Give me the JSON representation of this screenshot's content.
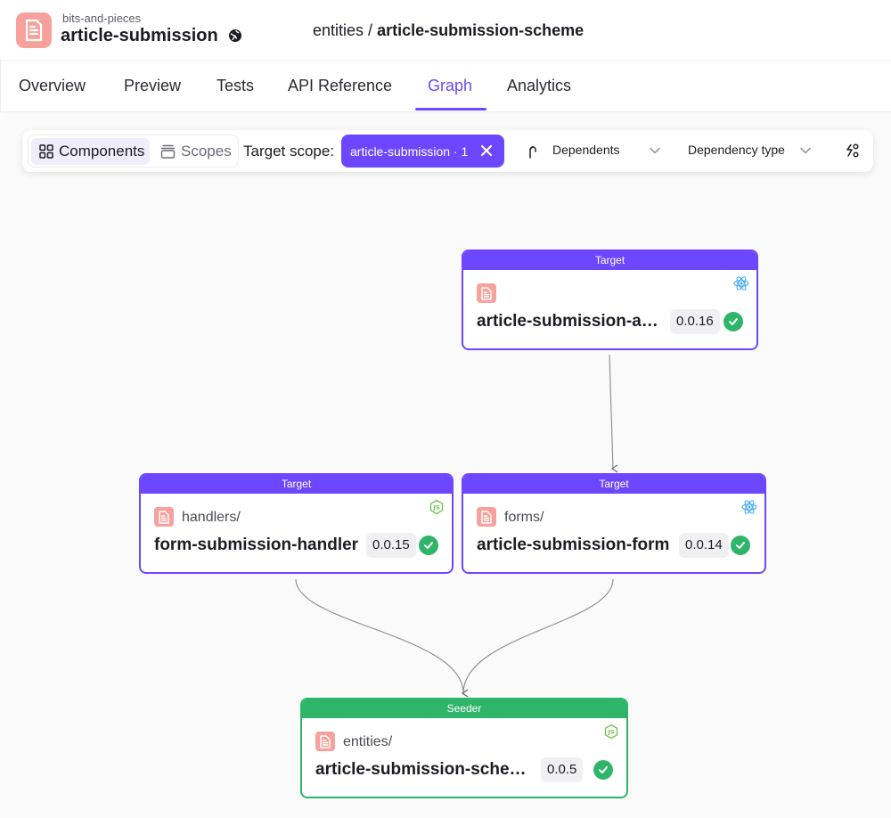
{
  "header": {
    "org": "bits-and-pieces",
    "scope": "article-submission",
    "breadcrumb_namespace": "entities",
    "breadcrumb_separator": " / ",
    "breadcrumb_component": "article-submission-scheme"
  },
  "tabs": [
    {
      "label": "Overview"
    },
    {
      "label": "Preview"
    },
    {
      "label": "Tests"
    },
    {
      "label": "API Reference"
    },
    {
      "label": "Graph",
      "active": true
    },
    {
      "label": "Analytics"
    }
  ],
  "toolbar": {
    "components_label": "Components",
    "scopes_label": "Scopes",
    "target_scope_label": "Target scope:",
    "target_scope_chip": "article-submission · 1",
    "dependents_label": "Dependents",
    "dependency_type_label": "Dependency type"
  },
  "nodes": [
    {
      "header": "Target",
      "namespace": "",
      "name": "article-submission-app",
      "version": "0.0.16",
      "env": "react-icon"
    },
    {
      "header": "Target",
      "namespace": "handlers/",
      "name": "form-submission-handler",
      "version": "0.0.15",
      "env": "nodejs-icon"
    },
    {
      "header": "Target",
      "namespace": "forms/",
      "name": "article-submission-form",
      "version": "0.0.14",
      "env": "react-icon"
    },
    {
      "header": "Seeder",
      "namespace": "entities/",
      "name": "article-submission-scheme",
      "version": "0.0.5",
      "env": "nodejs-icon"
    }
  ],
  "colors": {
    "accent": "#6c47ff",
    "seeder": "#2fb56a",
    "component_icon": "#f7a19c"
  }
}
